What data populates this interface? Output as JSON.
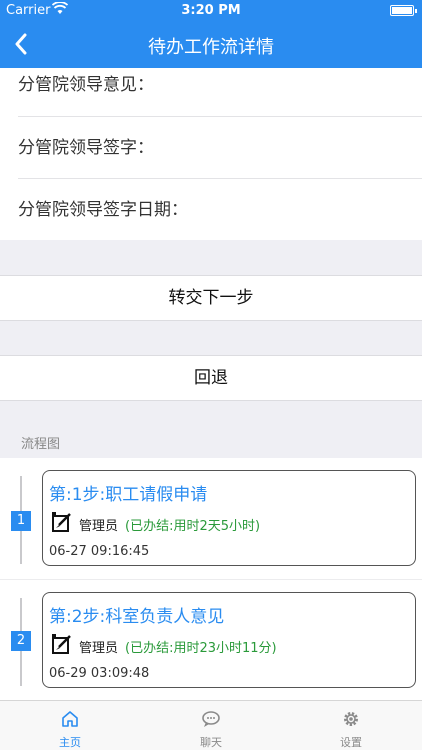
{
  "status_bar": {
    "carrier": "Carrier",
    "time": "3:20 PM"
  },
  "nav": {
    "title": "待办工作流详情"
  },
  "form": {
    "fields": [
      {
        "label": "分管院领导意见："
      },
      {
        "label": "分管院领导签字："
      },
      {
        "label": "分管院领导签字日期："
      }
    ]
  },
  "actions": {
    "next_label": "转交下一步",
    "back_label": "回退"
  },
  "flow": {
    "label": "流程图",
    "steps": [
      {
        "number": "1",
        "title": "第:1步:职工请假申请",
        "user": "管理员",
        "status": "(已办结:用时2天5小时)",
        "time": "06-27 09:16:45"
      },
      {
        "number": "2",
        "title": "第:2步:科室负责人意见",
        "user": "管理员",
        "status": "(已办结:用时23小时11分)",
        "time": "06-29 03:09:48"
      }
    ]
  },
  "tabbar": {
    "items": [
      {
        "label": "主页",
        "icon": "home-icon",
        "active": true
      },
      {
        "label": "聊天",
        "icon": "chat-icon",
        "active": false
      },
      {
        "label": "设置",
        "icon": "gear-icon",
        "active": false
      }
    ]
  },
  "colors": {
    "accent": "#2a8cf0",
    "status_green": "#2a9a3a",
    "background": "#efeff4"
  }
}
